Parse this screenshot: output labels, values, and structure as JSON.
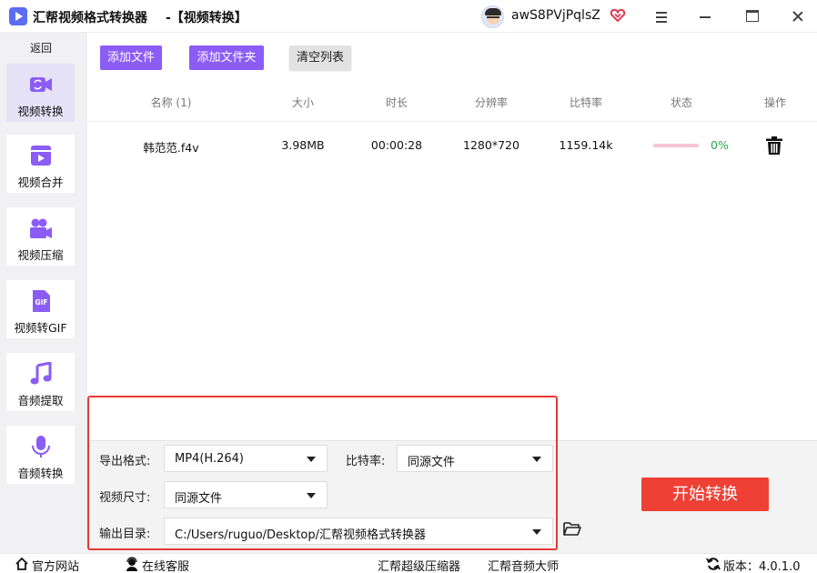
{
  "window": {
    "app_title": "汇帮视频格式转换器",
    "page_title": "-【视频转换】",
    "username": "awS8PVjPqlsZ",
    "vip_icon": "vip-heart-icon"
  },
  "sidebar": {
    "back_label": "返回",
    "items": [
      {
        "label": "视频转换",
        "icon": "video-convert-icon",
        "active": true
      },
      {
        "label": "视频合并",
        "icon": "video-merge-icon",
        "active": false
      },
      {
        "label": "视频压缩",
        "icon": "video-compress-icon",
        "active": false
      },
      {
        "label": "视频转GIF",
        "icon": "gif-icon",
        "active": false
      },
      {
        "label": "音频提取",
        "icon": "music-note-icon",
        "active": false
      },
      {
        "label": "音频转换",
        "icon": "microphone-icon",
        "active": false
      }
    ]
  },
  "toolbar": {
    "add_file": "添加文件",
    "add_folder": "添加文件夹",
    "clear_list": "清空列表"
  },
  "table": {
    "columns": [
      "名称 (1)",
      "大小",
      "时长",
      "分辨率",
      "比特率",
      "状态",
      "操作"
    ],
    "rows": [
      {
        "name": "韩范范.f4v",
        "size": "3.98MB",
        "duration": "00:00:28",
        "resolution": "1280*720",
        "bitrate": "1159.14k",
        "progress": 0,
        "progress_text": "0%"
      }
    ]
  },
  "settings": {
    "format_label": "导出格式:",
    "format_value": "MP4(H.264)",
    "bitrate_label": "比特率:",
    "bitrate_value": "同源文件",
    "size_label": "视频尺寸:",
    "size_value": "同源文件",
    "output_label": "输出目录:",
    "output_value": "C:/Users/ruguo/Desktop/汇帮视频格式转换器",
    "start_button": "开始转换"
  },
  "footer": {
    "website": "官方网站",
    "support": "在线客服",
    "compressor": "汇帮超级压缩器",
    "audio_master": "汇帮音频大师",
    "version": "版本：4.0.1.0"
  },
  "colors": {
    "accent": "#8b5cf6",
    "start": "#ef4035",
    "progress_ok": "#2aa84a",
    "highlight": "#e53935"
  }
}
